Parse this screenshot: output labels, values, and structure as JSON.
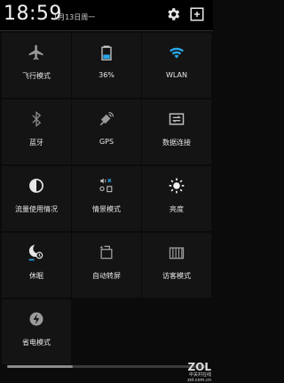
{
  "status": {
    "time": "18:59",
    "date": "1月13日周一"
  },
  "tiles": [
    {
      "label": "飞行模式"
    },
    {
      "label": "36%"
    },
    {
      "label": "WLAN"
    },
    {
      "label": "蓝牙"
    },
    {
      "label": "GPS"
    },
    {
      "label": "数据连接"
    },
    {
      "label": "流量使用情况"
    },
    {
      "label": "情景模式"
    },
    {
      "label": "亮度"
    },
    {
      "label": "休眠"
    },
    {
      "label": "自动转屏"
    },
    {
      "label": "访客模式"
    },
    {
      "label": "省电模式"
    }
  ],
  "brightness": {
    "level": 0.33
  },
  "watermark": {
    "logo": "ZOL",
    "text": "中关村在线 zol.com.cn"
  },
  "colors": {
    "wlan": "#2aa7e8",
    "battery": "#2aa7e8",
    "sleep_accent": "#2aa7e8",
    "mute": "#2aa7e8"
  }
}
